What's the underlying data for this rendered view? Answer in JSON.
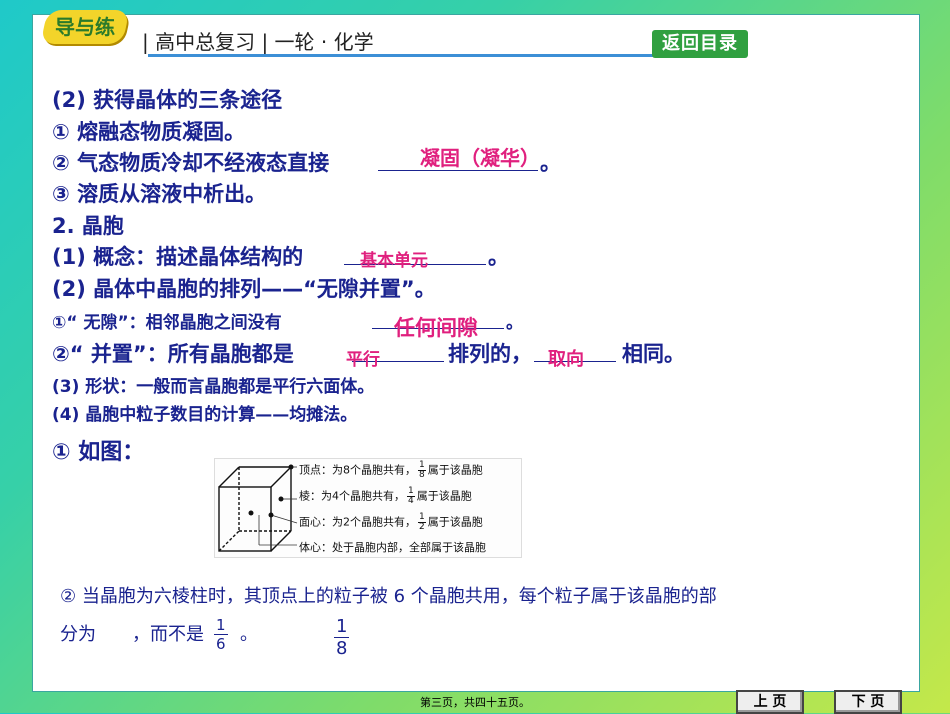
{
  "header": {
    "logo": "导与练",
    "course": "| 高中总复习 | 一轮 · 化学",
    "toc_button": "返回目录"
  },
  "lines": {
    "l1": "(2) 获得晶体的三条途径",
    "l2": "① 熔融态物质凝固。",
    "l3": "② 气态物质冷却不经液态直接",
    "l3_end": "。",
    "l4": "③ 溶质从溶液中析出。",
    "l5": "2. 晶胞",
    "l6": "(1) 概念：描述晶体结构的",
    "l6_end": "。",
    "l7": "(2) 晶体中晶胞的排列——“无隙并置”。",
    "l8": "①“ 无隙”：相邻晶胞之间没有",
    "l8_end": "。",
    "l9a": "②“ 并置”：所有晶胞都是",
    "l9b": "排列的，",
    "l9c": "相同。",
    "l10": "(3) 形状：一般而言晶胞都是平行六面体。",
    "l11": "(4) 晶胞中粒子数目的计算——均摊法。",
    "l12": "① 如图：",
    "l13": "② 当晶胞为六棱柱时，其顶点上的粒子被 6 个晶胞共用，每个粒子属于该晶胞的部",
    "l14a": "分为",
    "l14b": "，而不是",
    "l14c": "。"
  },
  "answers": {
    "a1": "凝固（凝华）",
    "a2": "基本单元",
    "a3": "任何间隙",
    "a4": "平行",
    "a5": "取向",
    "frac_answer": {
      "num": "1",
      "den": "6"
    },
    "frac_not": {
      "num": "1",
      "den": "8"
    },
    "frac_standalone": {
      "num": "1",
      "den": "8"
    }
  },
  "figure": {
    "vertex_a": "顶点：为8个晶胞共有，",
    "vertex_n": "1",
    "vertex_d": "8",
    "vertex_b": "属于该晶胞",
    "edge_a": "棱：为4个晶胞共有，",
    "edge_n": "1",
    "edge_d": "4",
    "edge_b": "属于该晶胞",
    "face_a": "面心：为2个晶胞共有，",
    "face_n": "1",
    "face_d": "2",
    "face_b": "属于该晶胞",
    "body": "体心：处于晶胞内部，全部属于该晶胞"
  },
  "footer": {
    "page_info": "第三页，共四十五页。",
    "prev": "上 页",
    "next": "下 页"
  },
  "colors": {
    "text": "#1a238f",
    "answer": "#e0207e",
    "toc": "#30a040"
  }
}
